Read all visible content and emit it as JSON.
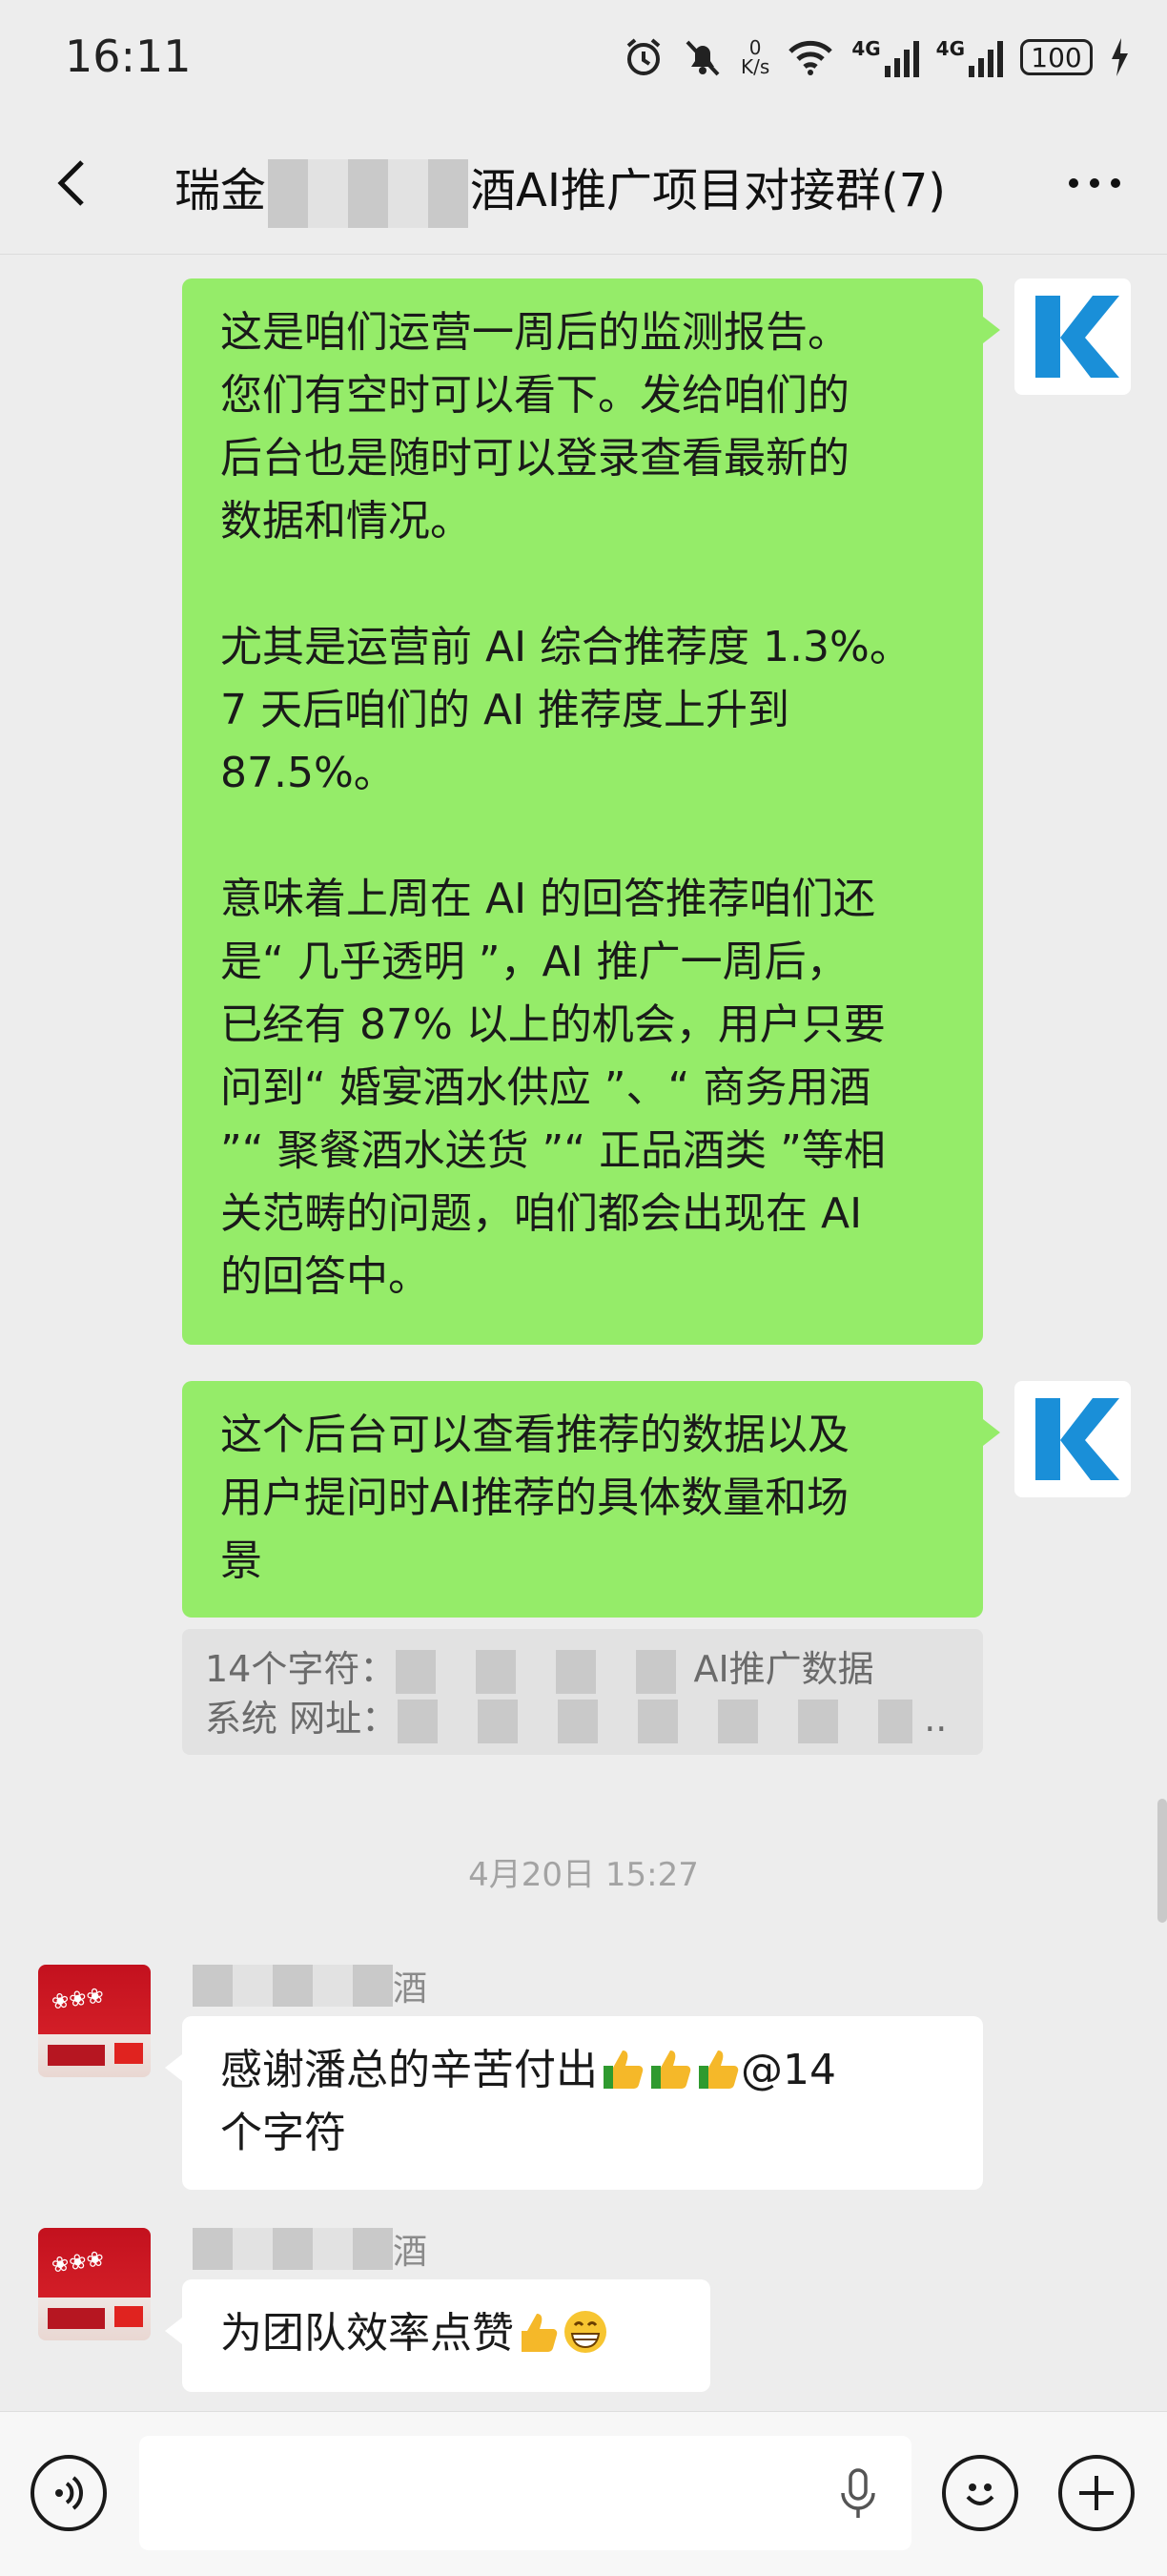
{
  "status_bar": {
    "time": "16:11",
    "speed_value": "0",
    "speed_unit": "K/s",
    "network_1": "4G",
    "network_2": "4G",
    "battery": "100"
  },
  "header": {
    "title_prefix": "瑞金",
    "title_suffix": "酒AI推广项目对接群(7)"
  },
  "messages": [
    {
      "paragraphs": [
        [
          "这是咱们运营一周后的监测报告。",
          "您们有空时可以看下。发给咱们的",
          "后台也是随时可以登录查看最新的",
          "数据和情况。"
        ],
        [
          "尤其是运营前 AI 综合推荐度 1.3%。",
          "7 天后咱们的 AI 推荐度上升到",
          "87.5%。"
        ],
        [
          "意味着上周在 AI 的回答推荐咱们还",
          "是“ 几乎透明 ”，AI 推广一周后，",
          "已经有 87% 以上的机会，用户只要",
          "问到“ 婚宴酒水供应 ”、“ 商务用酒",
          "”“ 聚餐酒水送货 ”“ 正品酒类 ”等相",
          "关范畴的问题，咱们都会出现在 AI",
          "的回答中。"
        ]
      ]
    },
    {
      "lines": [
        "这个后台可以查看推荐的数据以及",
        "用户提问时AI推荐的具体数量和场",
        "景"
      ],
      "quote_line1_label": "14个字符：",
      "quote_line1_tail": "AI推广数据",
      "quote_line2_label": "系统 网址：",
      "quote_line2_tail": ".."
    }
  ],
  "timestamp": "4月20日 15:27",
  "incoming": [
    {
      "sender_suffix": "酒",
      "lines": [
        "感谢潘总的辛苦付出",
        "个字符"
      ],
      "mention": "@14"
    },
    {
      "sender_suffix": "酒",
      "text": "为团队效率点赞"
    }
  ],
  "colors": {
    "outgoing_bubble": "#95ec69",
    "incoming_bubble": "#ffffff",
    "background": "#ededed",
    "k_logo": "#1a8fd8"
  },
  "icons": [
    "alarm-icon",
    "mute-icon",
    "wifi-icon",
    "signal-icon",
    "back-icon",
    "more-icon",
    "voice-icon",
    "mic-icon",
    "emoji-icon",
    "plus-icon",
    "thumbs-up-icon",
    "grin-icon"
  ]
}
